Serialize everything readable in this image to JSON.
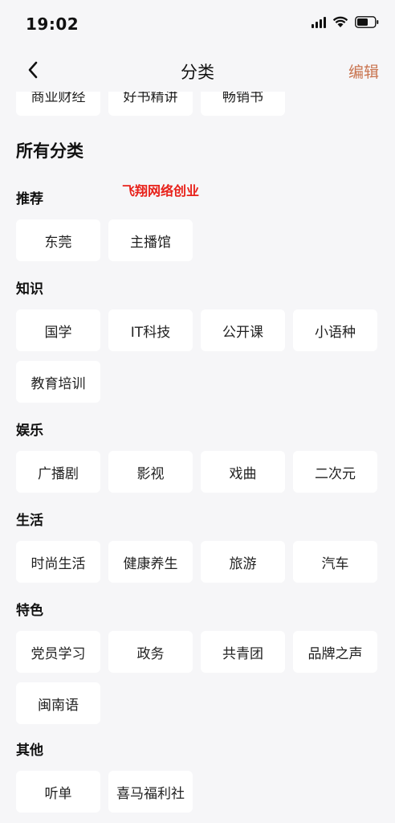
{
  "status_bar": {
    "time": "19:02"
  },
  "nav": {
    "title": "分类",
    "edit_label": "编辑"
  },
  "clipped_row": [
    "商业财经",
    "好书精讲",
    "畅销书"
  ],
  "all_title": "所有分类",
  "watermark": "飞翔网络创业",
  "sections": [
    {
      "title": "推荐",
      "items": [
        "东莞",
        "主播馆"
      ]
    },
    {
      "title": "知识",
      "items": [
        "国学",
        "IT科技",
        "公开课",
        "小语种",
        "教育培训"
      ]
    },
    {
      "title": "娱乐",
      "items": [
        "广播剧",
        "影视",
        "戏曲",
        "二次元"
      ]
    },
    {
      "title": "生活",
      "items": [
        "时尚生活",
        "健康养生",
        "旅游",
        "汽车"
      ]
    },
    {
      "title": "特色",
      "items": [
        "党员学习",
        "政务",
        "共青团",
        "品牌之声",
        "闽南语"
      ]
    },
    {
      "title": "其他",
      "items": [
        "听单",
        "喜马福利社"
      ]
    }
  ],
  "colors": {
    "accent": "#c9744f",
    "background": "#f6f6f8",
    "chip": "#ffffff",
    "watermark": "#e8211a"
  }
}
